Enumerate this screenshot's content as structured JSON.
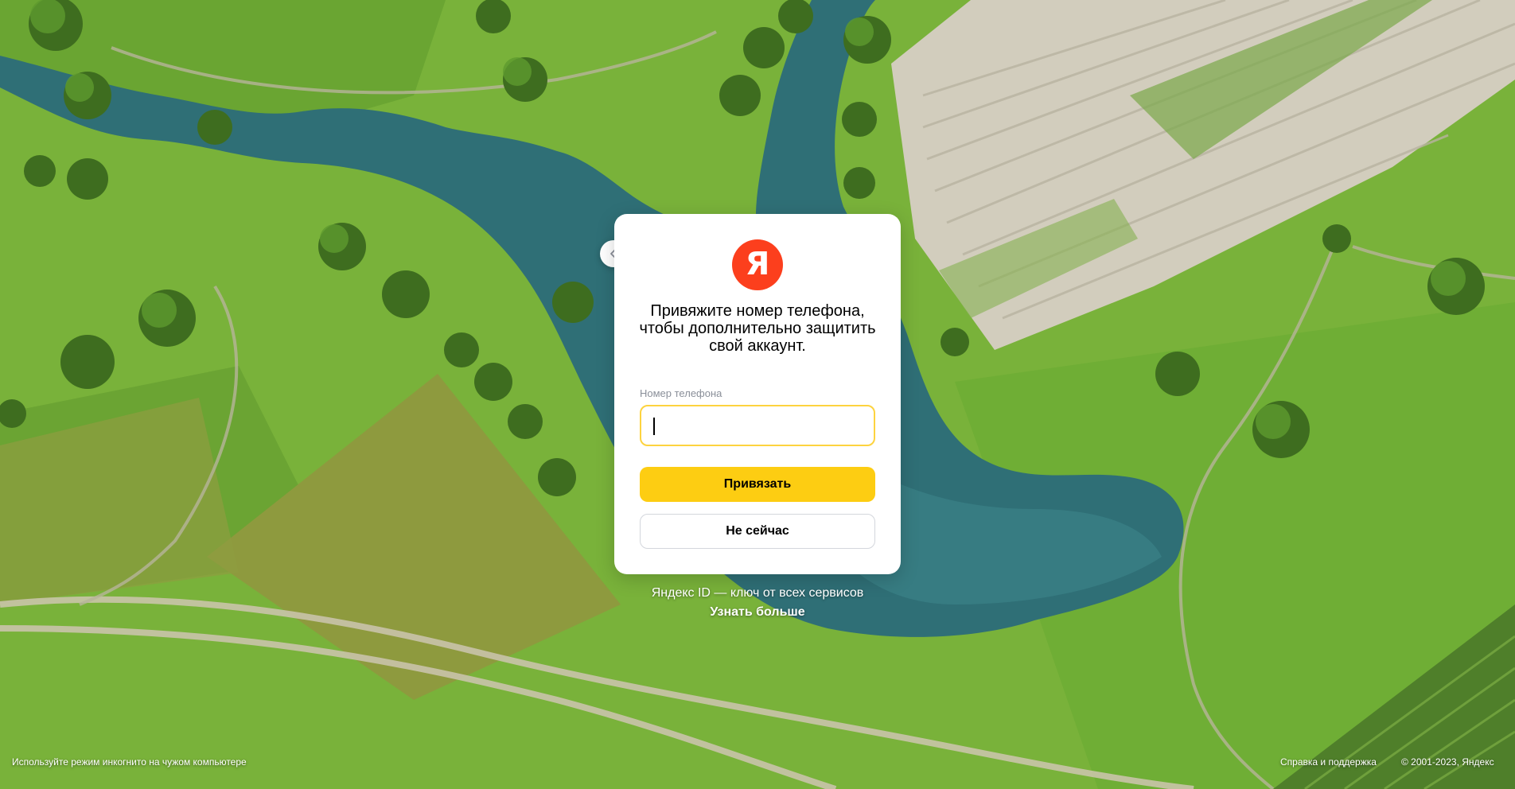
{
  "background": {
    "description_icon": "aerial-landscape-icon",
    "colors": {
      "grass": "#7bb33a",
      "grass_dark": "#5e9a2a",
      "water": "#2e6e74",
      "field": "#cfc9b8",
      "tree": "#3f6f1f"
    }
  },
  "back_button": {
    "icon": "chevron-left-icon"
  },
  "card": {
    "logo_letter": "Я",
    "logo_color": "#fc3f1d",
    "title": "Привяжите номер телефона, чтобы дополнительно защитить свой аккаунт.",
    "phone_label": "Номер телефона",
    "phone_value": "",
    "phone_placeholder": "",
    "primary_button": "Привязать",
    "secondary_button": "Не сейчас",
    "accent_color": "#fdcd12"
  },
  "promo": {
    "text": "Яндекс ID — ключ от всех сервисов",
    "link": "Узнать больше"
  },
  "footer": {
    "incognito_hint": "Используйте режим инкогнито на чужом компьютере",
    "help_link": "Справка и поддержка",
    "copyright": "© 2001-2023, Яндекс"
  }
}
